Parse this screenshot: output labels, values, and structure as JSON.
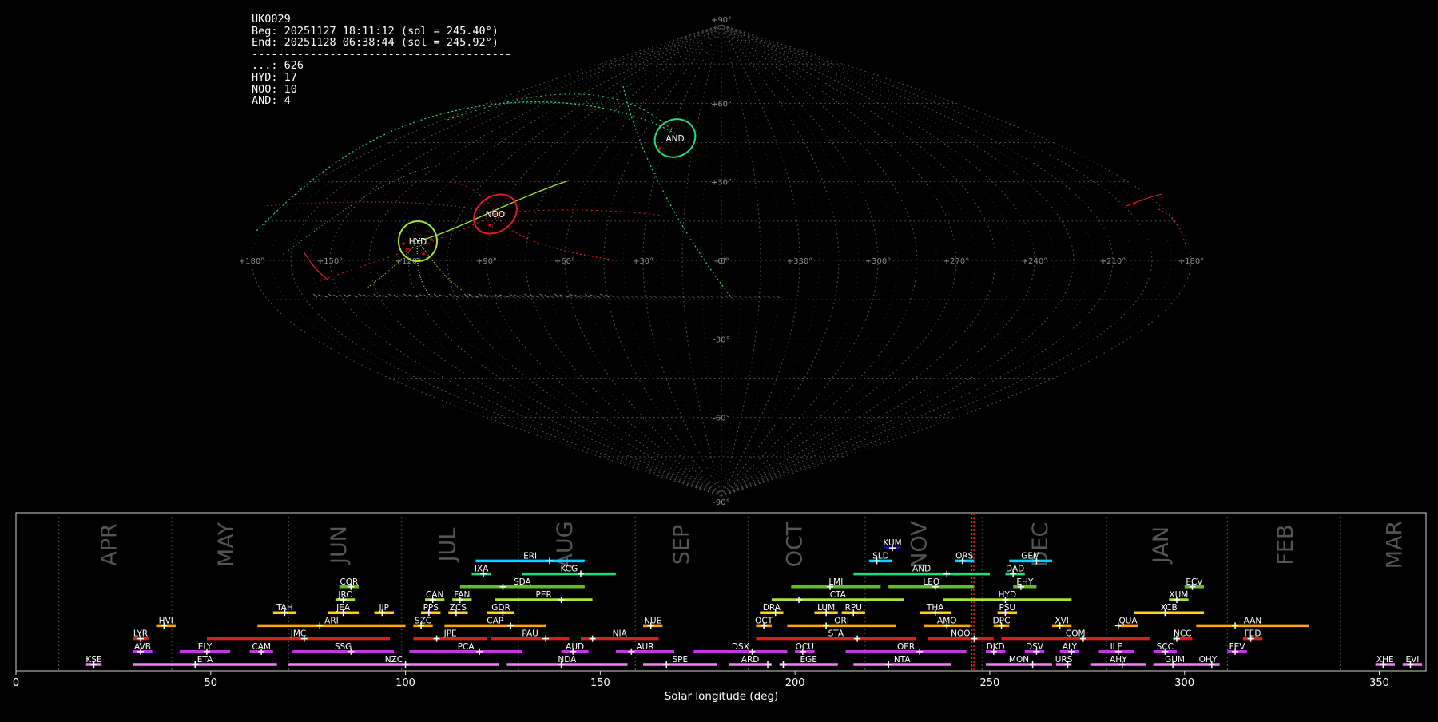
{
  "info": {
    "station": "UK0029",
    "beg": "Beg: 20251127 18:11:12 (sol = 245.40°)",
    "end": "End: 20251128 06:38:44 (sol = 245.92°)",
    "separator": "----------------------------------------",
    "counts": [
      {
        "label": "...",
        "value": 626
      },
      {
        "label": "HYD",
        "value": 17
      },
      {
        "label": "NOO",
        "value": 10
      },
      {
        "label": "AND",
        "value": 4
      }
    ]
  },
  "colors": {
    "background": "#000000",
    "grid": "#777777",
    "HYD": "#a3e635",
    "NOO": "#e11d1d",
    "AND": "#22dd77",
    "marker": "#e00000"
  },
  "sky_map": {
    "projection": "sinusoidal",
    "lat_labels": [
      "+90°",
      "+60°",
      "+30°",
      "0°",
      "-30°",
      "-60°",
      "-90°"
    ],
    "lon_labels": [
      "+180°",
      "+150°",
      "+120°",
      "+90°",
      "+60°",
      "+30°",
      "+0°",
      "+330°",
      "+300°",
      "+270°",
      "+240°",
      "+210°",
      "+180°"
    ],
    "radiants": [
      {
        "name": "HYD",
        "lon": 120,
        "lat": 7
      },
      {
        "name": "NOO",
        "lon": 92,
        "lat": 17
      },
      {
        "name": "AND",
        "lon": 29,
        "lat": 42
      }
    ]
  },
  "chart_data": {
    "type": "bar",
    "xlabel": "Solar longitude (deg)",
    "ylabel": "",
    "xlim": [
      0,
      362
    ],
    "x_ticks": [
      0,
      50,
      100,
      150,
      200,
      250,
      300,
      350
    ],
    "grid": "vertical dotted month boundaries",
    "current_sol": [
      245.4,
      245.92
    ],
    "months": [
      {
        "name": "APR",
        "start": 11,
        "mid": 24
      },
      {
        "name": "MAY",
        "start": 40,
        "mid": 54
      },
      {
        "name": "JUN",
        "start": 70,
        "mid": 83
      },
      {
        "name": "JUL",
        "start": 99,
        "mid": 111
      },
      {
        "name": "AUG",
        "start": 129,
        "mid": 141
      },
      {
        "name": "SEP",
        "start": 159,
        "mid": 171
      },
      {
        "name": "OCT",
        "start": 188,
        "mid": 200
      },
      {
        "name": "NOV",
        "start": 218,
        "mid": 232
      },
      {
        "name": "DEC",
        "start": 248,
        "mid": 263
      },
      {
        "name": "JAN",
        "start": 280,
        "mid": 294
      },
      {
        "name": "FEB",
        "start": 311,
        "mid": 326
      },
      {
        "name": "MAR",
        "start": 340,
        "mid": 354
      }
    ],
    "showers": [
      {
        "code": "KUM",
        "start": 223,
        "end": 227,
        "peak": 225,
        "row": 11,
        "color": "#1111cc"
      },
      {
        "code": "ERI",
        "start": 118,
        "end": 146,
        "peak": 137,
        "row": 10,
        "color": "#00d4ff"
      },
      {
        "code": "SLD",
        "start": 219,
        "end": 225,
        "peak": 221,
        "row": 10,
        "color": "#00d4ff"
      },
      {
        "code": "ORS",
        "start": 241,
        "end": 246,
        "peak": 243,
        "row": 10,
        "color": "#00d4ff"
      },
      {
        "code": "GEM",
        "start": 255,
        "end": 266,
        "peak": 262,
        "row": 10,
        "color": "#00d4ff"
      },
      {
        "code": "IXA",
        "start": 117,
        "end": 122,
        "peak": 120,
        "row": 9,
        "color": "#22dd77"
      },
      {
        "code": "KCG",
        "start": 130,
        "end": 154,
        "peak": 145,
        "row": 9,
        "color": "#22dd77"
      },
      {
        "code": "AND",
        "start": 215,
        "end": 250,
        "peak": 239,
        "row": 9,
        "color": "#22dd77"
      },
      {
        "code": "DAD",
        "start": 254,
        "end": 259,
        "peak": 256,
        "row": 9,
        "color": "#22dd77"
      },
      {
        "code": "COR",
        "start": 83,
        "end": 88,
        "peak": 86,
        "row": 8,
        "color": "#66bb22"
      },
      {
        "code": "SDA",
        "start": 114,
        "end": 146,
        "peak": 125,
        "row": 8,
        "color": "#66bb22"
      },
      {
        "code": "LMI",
        "start": 199,
        "end": 222,
        "peak": 209,
        "row": 8,
        "color": "#66bb22"
      },
      {
        "code": "LEO",
        "start": 224,
        "end": 246,
        "peak": 236,
        "row": 8,
        "color": "#66bb22"
      },
      {
        "code": "EHY",
        "start": 256,
        "end": 262,
        "peak": 258,
        "row": 8,
        "color": "#66bb22"
      },
      {
        "code": "ECV",
        "start": 300,
        "end": 305,
        "peak": 302,
        "row": 8,
        "color": "#66bb22"
      },
      {
        "code": "JRC",
        "start": 82,
        "end": 87,
        "peak": 84,
        "row": 7,
        "color": "#a3e635"
      },
      {
        "code": "CAN",
        "start": 105,
        "end": 110,
        "peak": 107,
        "row": 7,
        "color": "#a3e635"
      },
      {
        "code": "FAN",
        "start": 112,
        "end": 117,
        "peak": 114,
        "row": 7,
        "color": "#a3e635"
      },
      {
        "code": "PER",
        "start": 123,
        "end": 148,
        "peak": 140,
        "row": 7,
        "color": "#a3e635"
      },
      {
        "code": "CTA",
        "start": 194,
        "end": 228,
        "peak": 201,
        "row": 7,
        "color": "#a3e635"
      },
      {
        "code": "HYD",
        "start": 238,
        "end": 271,
        "peak": 254,
        "row": 7,
        "color": "#a3e635"
      },
      {
        "code": "XUM",
        "start": 296,
        "end": 301,
        "peak": 298,
        "row": 7,
        "color": "#a3e635"
      },
      {
        "code": "TAH",
        "start": 66,
        "end": 72,
        "peak": 69,
        "row": 6,
        "color": "#ffd400"
      },
      {
        "code": "JEA",
        "start": 80,
        "end": 88,
        "peak": 84,
        "row": 6,
        "color": "#ffd400"
      },
      {
        "code": "JIP",
        "start": 92,
        "end": 97,
        "peak": 94,
        "row": 6,
        "color": "#ffd400"
      },
      {
        "code": "PPS",
        "start": 104,
        "end": 109,
        "peak": 106,
        "row": 6,
        "color": "#ffd400"
      },
      {
        "code": "ZCS",
        "start": 111,
        "end": 116,
        "peak": 113,
        "row": 6,
        "color": "#ffd400"
      },
      {
        "code": "GDR",
        "start": 121,
        "end": 128,
        "peak": 125,
        "row": 6,
        "color": "#ffd400"
      },
      {
        "code": "DRA",
        "start": 191,
        "end": 197,
        "peak": 195,
        "row": 6,
        "color": "#ffd400"
      },
      {
        "code": "LUM",
        "start": 205,
        "end": 211,
        "peak": 208,
        "row": 6,
        "color": "#ffd400"
      },
      {
        "code": "RPU",
        "start": 212,
        "end": 218,
        "peak": 215,
        "row": 6,
        "color": "#ffd400"
      },
      {
        "code": "THA",
        "start": 232,
        "end": 240,
        "peak": 236,
        "row": 6,
        "color": "#ffd400"
      },
      {
        "code": "PSU",
        "start": 252,
        "end": 257,
        "peak": 254,
        "row": 6,
        "color": "#ffd400"
      },
      {
        "code": "XCB",
        "start": 287,
        "end": 305,
        "peak": 295,
        "row": 6,
        "color": "#ffd400"
      },
      {
        "code": "HVI",
        "start": 36,
        "end": 41,
        "peak": 38,
        "row": 5,
        "color": "#ffa500"
      },
      {
        "code": "ARI",
        "start": 62,
        "end": 100,
        "peak": 78,
        "row": 5,
        "color": "#ffa500"
      },
      {
        "code": "SZC",
        "start": 102,
        "end": 107,
        "peak": 104,
        "row": 5,
        "color": "#ffa500"
      },
      {
        "code": "CAP",
        "start": 110,
        "end": 136,
        "peak": 127,
        "row": 5,
        "color": "#ffa500"
      },
      {
        "code": "NUE",
        "start": 161,
        "end": 166,
        "peak": 163,
        "row": 5,
        "color": "#ffa500"
      },
      {
        "code": "OCT",
        "start": 190,
        "end": 194,
        "peak": 192,
        "row": 5,
        "color": "#ffa500"
      },
      {
        "code": "ORI",
        "start": 198,
        "end": 226,
        "peak": 208,
        "row": 5,
        "color": "#ffa500"
      },
      {
        "code": "AMO",
        "start": 233,
        "end": 245,
        "peak": 239,
        "row": 5,
        "color": "#ffa500"
      },
      {
        "code": "DPC",
        "start": 251,
        "end": 255,
        "peak": 253,
        "row": 5,
        "color": "#ffa500"
      },
      {
        "code": "XVI",
        "start": 266,
        "end": 271,
        "peak": 268,
        "row": 5,
        "color": "#ffa500"
      },
      {
        "code": "QUA",
        "start": 283,
        "end": 288,
        "peak": 283,
        "row": 5,
        "color": "#ffa500"
      },
      {
        "code": "AAN",
        "start": 303,
        "end": 332,
        "peak": 313,
        "row": 5,
        "color": "#ffa500"
      },
      {
        "code": "LYR",
        "start": 30,
        "end": 34,
        "peak": 32,
        "row": 4,
        "color": "#e31a1c"
      },
      {
        "code": "JMC",
        "start": 49,
        "end": 96,
        "peak": 74,
        "row": 4,
        "color": "#e31a1c"
      },
      {
        "code": "JPE",
        "start": 102,
        "end": 121,
        "peak": 108,
        "row": 4,
        "color": "#e31a1c"
      },
      {
        "code": "PAU",
        "start": 122,
        "end": 142,
        "peak": 136,
        "row": 4,
        "color": "#e31a1c"
      },
      {
        "code": "NIA",
        "start": 145,
        "end": 165,
        "peak": 148,
        "row": 4,
        "color": "#e31a1c"
      },
      {
        "code": "STA",
        "start": 190,
        "end": 231,
        "peak": 216,
        "row": 4,
        "color": "#e31a1c"
      },
      {
        "code": "NOO",
        "start": 234,
        "end": 251,
        "peak": 246,
        "row": 4,
        "color": "#e31a1c"
      },
      {
        "code": "COM",
        "start": 253,
        "end": 291,
        "peak": 274,
        "row": 4,
        "color": "#e31a1c"
      },
      {
        "code": "NCC",
        "start": 297,
        "end": 302,
        "peak": 298,
        "row": 4,
        "color": "#e31a1c"
      },
      {
        "code": "FED",
        "start": 315,
        "end": 320,
        "peak": 317,
        "row": 4,
        "color": "#e31a1c"
      },
      {
        "code": "AVB",
        "start": 30,
        "end": 35,
        "peak": 32,
        "row": 3,
        "color": "#c038e0"
      },
      {
        "code": "ELY",
        "start": 42,
        "end": 55,
        "peak": 49,
        "row": 3,
        "color": "#c038e0"
      },
      {
        "code": "CAM",
        "start": 60,
        "end": 66,
        "peak": 63,
        "row": 3,
        "color": "#c038e0"
      },
      {
        "code": "SSG",
        "start": 71,
        "end": 97,
        "peak": 86,
        "row": 3,
        "color": "#c038e0"
      },
      {
        "code": "PCA",
        "start": 101,
        "end": 130,
        "peak": 119,
        "row": 3,
        "color": "#c038e0"
      },
      {
        "code": "AUD",
        "start": 140,
        "end": 147,
        "peak": 143,
        "row": 3,
        "color": "#c038e0"
      },
      {
        "code": "AUR",
        "start": 154,
        "end": 169,
        "peak": 158,
        "row": 3,
        "color": "#c038e0"
      },
      {
        "code": "DSX",
        "start": 174,
        "end": 198,
        "peak": 189,
        "row": 3,
        "color": "#c038e0"
      },
      {
        "code": "OCU",
        "start": 200,
        "end": 205,
        "peak": 202,
        "row": 3,
        "color": "#c038e0"
      },
      {
        "code": "OER",
        "start": 213,
        "end": 244,
        "peak": 232,
        "row": 3,
        "color": "#c038e0"
      },
      {
        "code": "DKD",
        "start": 249,
        "end": 254,
        "peak": 251,
        "row": 3,
        "color": "#c038e0"
      },
      {
        "code": "DSV",
        "start": 259,
        "end": 264,
        "peak": 262,
        "row": 3,
        "color": "#c038e0"
      },
      {
        "code": "ALY",
        "start": 268,
        "end": 273,
        "peak": 271,
        "row": 3,
        "color": "#c038e0"
      },
      {
        "code": "ILE",
        "start": 278,
        "end": 287,
        "peak": 283,
        "row": 3,
        "color": "#c038e0"
      },
      {
        "code": "SCC",
        "start": 292,
        "end": 298,
        "peak": 295,
        "row": 3,
        "color": "#c038e0"
      },
      {
        "code": "FEV",
        "start": 311,
        "end": 316,
        "peak": 313,
        "row": 3,
        "color": "#c038e0"
      },
      {
        "code": "KSE",
        "start": 18,
        "end": 22,
        "peak": 20,
        "row": 2,
        "color": "#ee82ee"
      },
      {
        "code": "ETA",
        "start": 30,
        "end": 67,
        "peak": 46,
        "row": 2,
        "color": "#ee82ee"
      },
      {
        "code": "NZC",
        "start": 70,
        "end": 124,
        "peak": 100,
        "row": 2,
        "color": "#ee82ee"
      },
      {
        "code": "NDA",
        "start": 126,
        "end": 157,
        "peak": 140,
        "row": 2,
        "color": "#ee82ee"
      },
      {
        "code": "SPE",
        "start": 161,
        "end": 180,
        "peak": 167,
        "row": 2,
        "color": "#ee82ee"
      },
      {
        "code": "ARD",
        "start": 183,
        "end": 194,
        "peak": 193,
        "row": 2,
        "color": "#ee82ee"
      },
      {
        "code": "EGE",
        "start": 196,
        "end": 211,
        "peak": 197,
        "row": 2,
        "color": "#ee82ee"
      },
      {
        "code": "NTA",
        "start": 215,
        "end": 240,
        "peak": 224,
        "row": 2,
        "color": "#ee82ee"
      },
      {
        "code": "MON",
        "start": 249,
        "end": 266,
        "peak": 261,
        "row": 2,
        "color": "#ee82ee"
      },
      {
        "code": "URS",
        "start": 267,
        "end": 271,
        "peak": 270,
        "row": 2,
        "color": "#ee82ee"
      },
      {
        "code": "AHY",
        "start": 276,
        "end": 290,
        "peak": 284,
        "row": 2,
        "color": "#ee82ee"
      },
      {
        "code": "GUM",
        "start": 292,
        "end": 303,
        "peak": 297,
        "row": 2,
        "color": "#ee82ee"
      },
      {
        "code": "OHY",
        "start": 303,
        "end": 309,
        "peak": 307,
        "row": 2,
        "color": "#ee82ee"
      },
      {
        "code": "XHE",
        "start": 349,
        "end": 354,
        "peak": 351,
        "row": 2,
        "color": "#ee82ee"
      },
      {
        "code": "EVI",
        "start": 356,
        "end": 361,
        "peak": 358,
        "row": 2,
        "color": "#ee82ee"
      }
    ]
  }
}
